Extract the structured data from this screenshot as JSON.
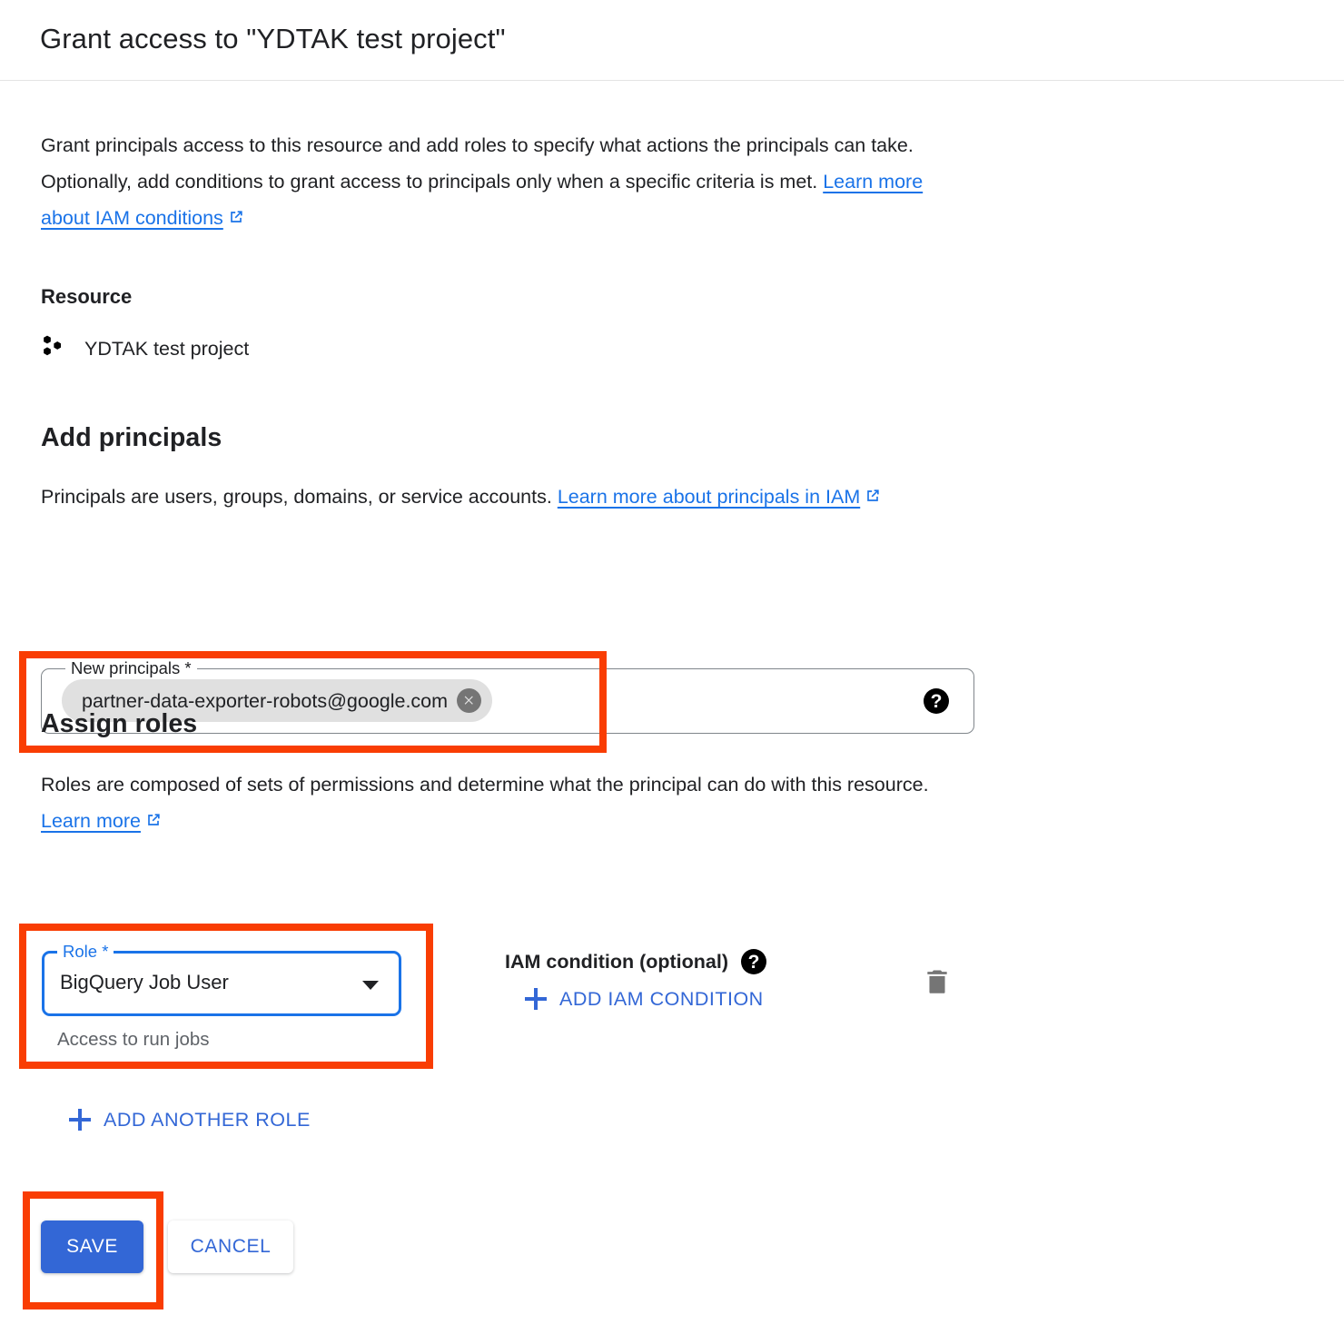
{
  "header": {
    "title": "Grant access to \"YDTAK test project\""
  },
  "intro": {
    "text": "Grant principals access to this resource and add roles to specify what actions the principals can take. Optionally, add conditions to grant access to principals only when a specific criteria is met. ",
    "link_label": "Learn more about IAM conditions"
  },
  "resource": {
    "heading": "Resource",
    "name": "YDTAK test project",
    "icon": "project-icon"
  },
  "add_principals": {
    "heading": "Add principals",
    "desc_text": "Principals are users, groups, domains, or service accounts. ",
    "link_label": "Learn more about principals in IAM",
    "field": {
      "label": "New principals *",
      "chip_value": "partner-data-exporter-robots@google.com",
      "chip_remove_icon": "chip-close-icon",
      "help_icon": "help-icon"
    }
  },
  "assign_roles": {
    "heading": "Assign roles",
    "desc_text": "Roles are composed of sets of permissions and determine what the principal can do with this resource. ",
    "link_label": "Learn more",
    "role_select": {
      "label": "Role *",
      "value": "BigQuery Job User",
      "hint": "Access to run jobs",
      "arrow_icon": "chevron-down-icon"
    },
    "iam_condition": {
      "label": "IAM condition (optional)",
      "help_icon": "help-icon",
      "add_label": "ADD IAM CONDITION",
      "add_icon": "plus-icon"
    },
    "delete_icon": "trash-icon",
    "add_another_role_label": "ADD ANOTHER ROLE",
    "add_another_role_icon": "plus-icon"
  },
  "footer": {
    "save_label": "SAVE",
    "cancel_label": "CANCEL"
  },
  "colors": {
    "accent_blue": "#1a73e8",
    "button_blue": "#3367d6",
    "highlight_red": "#f93d03",
    "chip_gray": "#e0e0e0",
    "hint_gray": "#5f6368"
  }
}
